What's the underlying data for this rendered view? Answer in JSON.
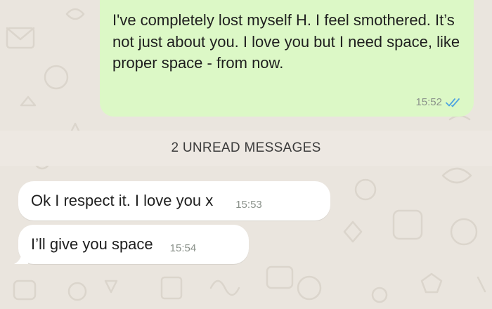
{
  "chat": {
    "outgoing": {
      "text": "I've completely lost myself H. I feel smothered. It’s not just about you. I love you but I need space, like proper space - from now.",
      "time": "15:52",
      "status_icon": "double-check-read-icon",
      "status_color": "#4fa3e0"
    },
    "unread_banner": "2 UNREAD MESSAGES",
    "incoming": [
      {
        "text": "Ok I respect it. I love you x",
        "time": "15:53"
      },
      {
        "text": "I’ll give you space",
        "time": "15:54"
      }
    ]
  },
  "colors": {
    "background": "#eae5de",
    "outgoing_bubble": "#dcf8c6",
    "incoming_bubble": "#ffffff",
    "banner": "#ede8e2"
  }
}
